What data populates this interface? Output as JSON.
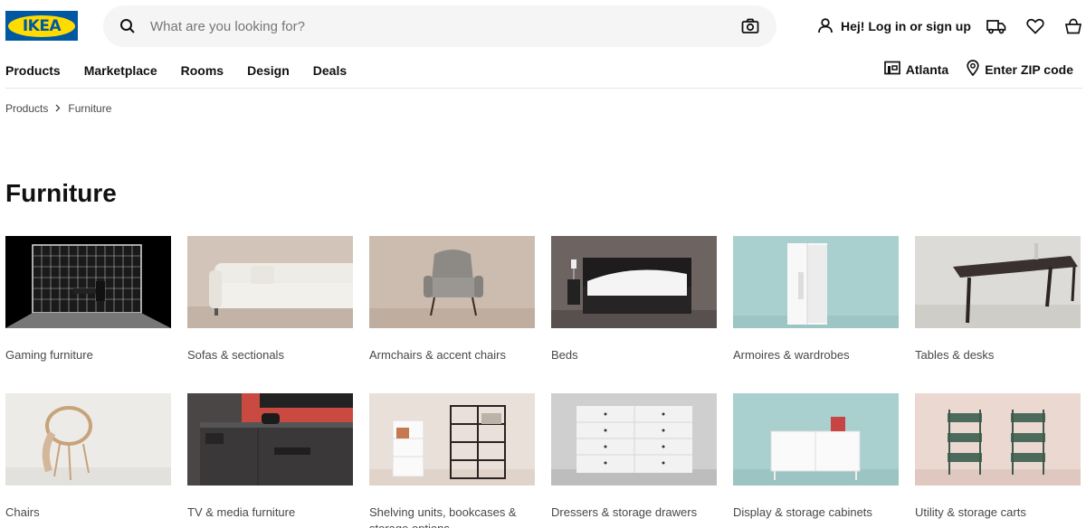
{
  "header": {
    "logo_text": "IKEA",
    "search_placeholder": "What are you looking for?",
    "login_label": "Hej! Log in or sign up"
  },
  "nav": {
    "items": [
      "Products",
      "Marketplace",
      "Rooms",
      "Design",
      "Deals"
    ],
    "store_label": "Atlanta",
    "zip_label": "Enter ZIP code"
  },
  "breadcrumb": {
    "items": [
      "Products",
      "Furniture"
    ]
  },
  "page": {
    "title": "Furniture"
  },
  "categories": [
    {
      "label": "Gaming furniture"
    },
    {
      "label": "Sofas & sectionals"
    },
    {
      "label": "Armchairs & accent chairs"
    },
    {
      "label": "Beds"
    },
    {
      "label": "Armoires & wardrobes"
    },
    {
      "label": "Tables & desks"
    },
    {
      "label": "Chairs"
    },
    {
      "label": "TV & media furniture"
    },
    {
      "label": "Shelving units, bookcases & storage options"
    },
    {
      "label": "Dressers & storage drawers"
    },
    {
      "label": "Display & storage cabinets"
    },
    {
      "label": "Utility & storage carts"
    }
  ],
  "colors": {
    "brand_blue": "#0058a3",
    "brand_yellow": "#ffdb00"
  }
}
